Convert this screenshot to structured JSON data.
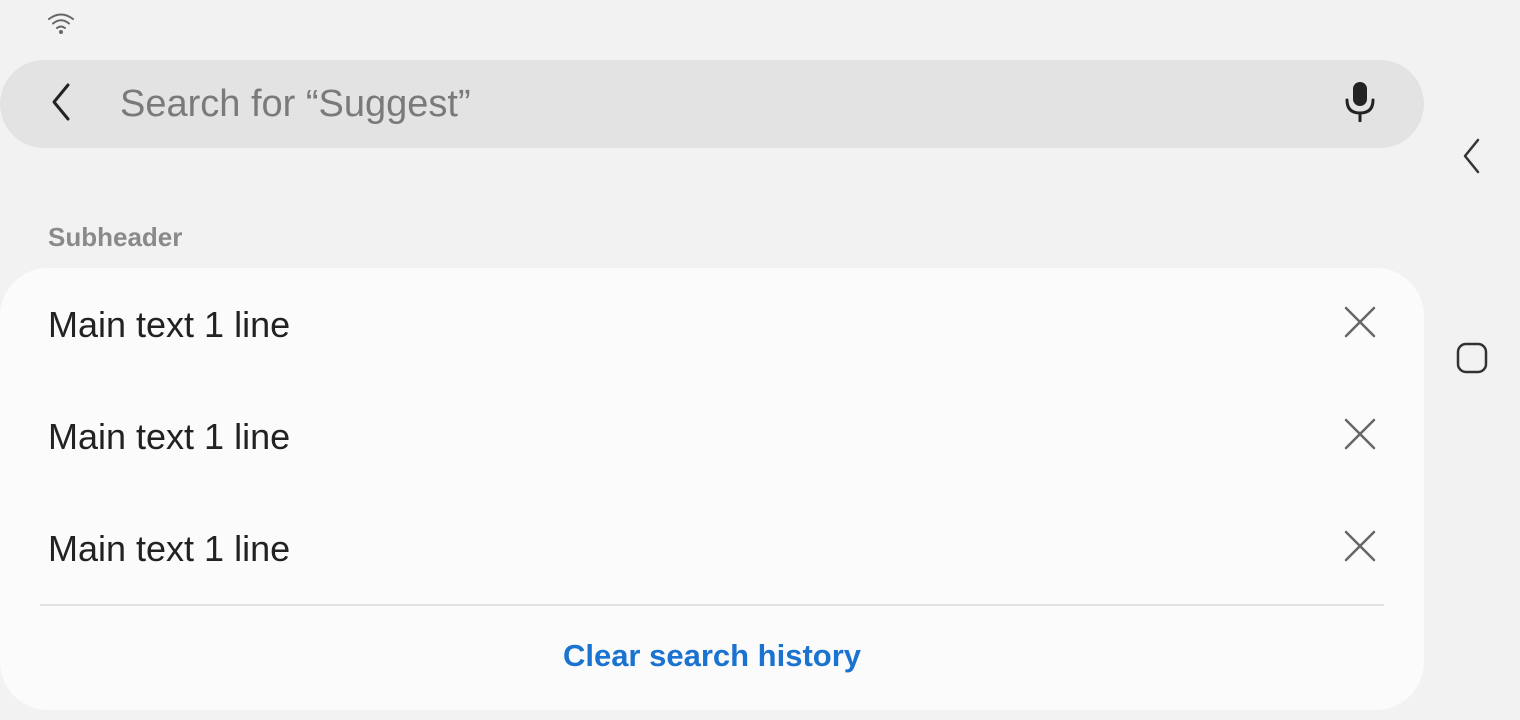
{
  "status_bar": {
    "wifi_icon": "wifi-icon"
  },
  "search": {
    "placeholder": "Search for “Suggest”",
    "value": "",
    "back_icon": "chevron-left-icon",
    "mic_icon": "microphone-icon"
  },
  "history": {
    "subheader": "Subheader",
    "items": [
      {
        "label": "Main text 1 line",
        "remove_icon": "close-icon"
      },
      {
        "label": "Main text 1 line",
        "remove_icon": "close-icon"
      },
      {
        "label": "Main text 1 line",
        "remove_icon": "close-icon"
      }
    ],
    "clear_label": "Clear search history"
  },
  "nav_bar": {
    "back_icon": "chevron-left-icon",
    "home_icon": "home-square-icon"
  },
  "colors": {
    "accent": "#1a73d1",
    "background": "#f2f2f2",
    "card": "#fbfbfb",
    "search_bar": "#e3e3e3"
  }
}
